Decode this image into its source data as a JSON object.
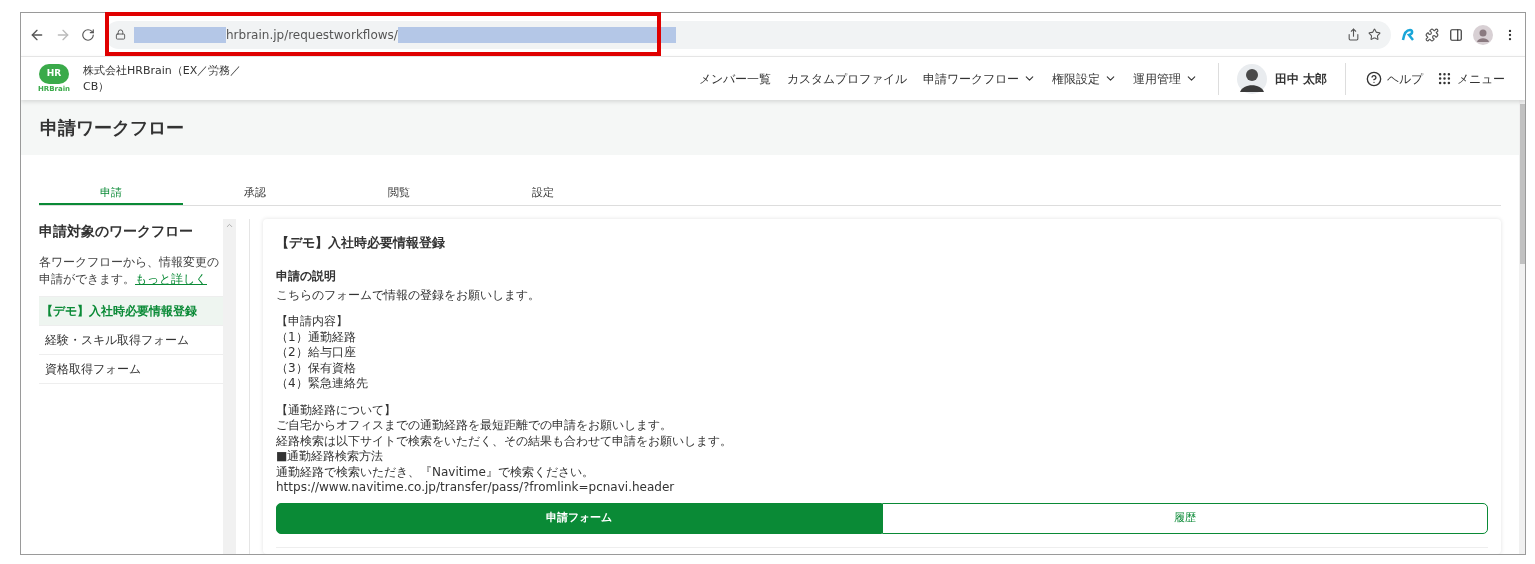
{
  "browser": {
    "url": "hrbrain.jp/requestworkflows/"
  },
  "header": {
    "logo_mark": "HR",
    "logo_text": "HRBrain",
    "company": "株式会社HRBrain（EX／労務／CB）",
    "nav": [
      {
        "label": "メンバー一覧",
        "has_menu": false
      },
      {
        "label": "カスタムプロファイル",
        "has_menu": false
      },
      {
        "label": "申請ワークフロー",
        "has_menu": true
      },
      {
        "label": "権限設定",
        "has_menu": true
      },
      {
        "label": "運用管理",
        "has_menu": true
      }
    ],
    "user_name": "田中 太郎",
    "help": "ヘルプ",
    "menu": "メニュー"
  },
  "page_title": "申請ワークフロー",
  "tabs": [
    {
      "label": "申請",
      "selected": true
    },
    {
      "label": "承認",
      "selected": false
    },
    {
      "label": "閲覧",
      "selected": false
    },
    {
      "label": "設定",
      "selected": false
    }
  ],
  "sidebar": {
    "title": "申請対象のワークフロー",
    "description": "各ワークフローから、情報変更の申請ができます。",
    "link": "もっと詳しく",
    "items": [
      {
        "label": "【デモ】入社時必要情報登録",
        "selected": true
      },
      {
        "label": "経験・スキル取得フォーム",
        "selected": false
      },
      {
        "label": "資格取得フォーム",
        "selected": false
      }
    ]
  },
  "card": {
    "title": "【デモ】入社時必要情報登録",
    "section_label": "申請の説明",
    "paragraphs": [
      [
        "こちらのフォームで情報の登録をお願いします。"
      ],
      [
        "【申請内容】",
        "（1）通勤経路",
        "（2）給与口座",
        "（3）保有資格",
        "（4）緊急連絡先"
      ],
      [
        "【通勤経路について】",
        "ご自宅からオフィスまでの通勤経路を最短距離での申請をお願いします。",
        "経路検索は以下サイトで検索をいただく、その結果も合わせて申請をお願いします。",
        "■通勤経路検索方法",
        "通勤経路で検索いただき、『Navitime』で検索ください。",
        "https://www.navitime.co.jp/transfer/pass/?fromlink=pcnavi.header"
      ]
    ],
    "buttons": [
      {
        "label": "申請フォーム",
        "selected": true
      },
      {
        "label": "履歴",
        "selected": false
      }
    ]
  }
}
